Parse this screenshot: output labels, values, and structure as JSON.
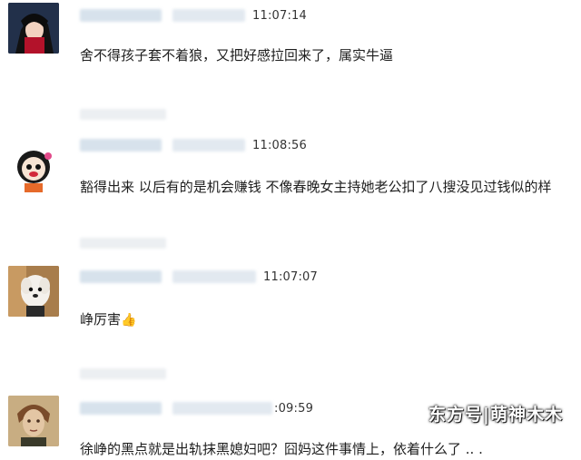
{
  "comments": [
    {
      "time": "11:07:14",
      "text": "舍不得孩子套不着狼，又把好感拉回来了，属实牛逼",
      "avatar_icon": "anime-avatar-icon"
    },
    {
      "time": "11:08:56",
      "text": "豁得出来 以后有的是机会赚钱 不像春晚女主持她老公扣了八搜没见过钱似的样",
      "avatar_icon": "cartoon-girl-avatar-icon"
    },
    {
      "time": "11:07:07",
      "text": "峥厉害",
      "emoji": "👍",
      "avatar_icon": "dog-avatar-icon"
    },
    {
      "time": ":09:59",
      "text": "徐峥的黑点就是出轨抹黑媳妇吧？囧妈这件事情上，依着什么了 ..  .",
      "avatar_icon": "portrait-avatar-icon"
    }
  ],
  "watermark": "东方号|萌神木木"
}
